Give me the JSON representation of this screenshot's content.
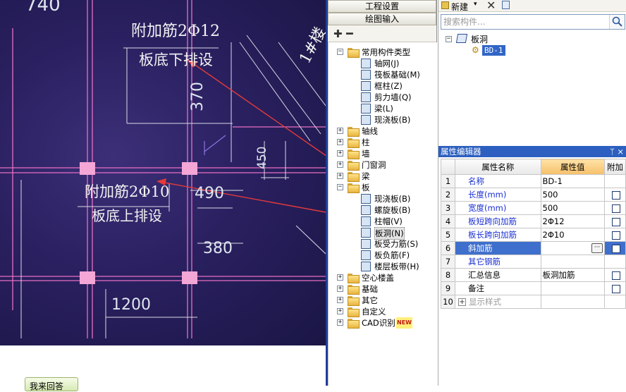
{
  "cad": {
    "top_number": "740",
    "label_upper_line1": "附加筋2Φ12",
    "label_upper_line2": "板底下排设",
    "label_lower_line1": "附加筋2Φ10",
    "label_lower_line2": "板底上排设",
    "dim_370": "370",
    "dim_490": "490",
    "dim_380": "380",
    "dim_1200": "1200",
    "dim_450": "450",
    "diag_text": "1#楼",
    "arrow_color": "#e53a3a"
  },
  "answer_button": "我来回答",
  "nav": {
    "project_settings": "工程设置",
    "drawing_input": "绘图输入",
    "tree": [
      {
        "label": "常用构件类型",
        "icon": "folder-open-icon",
        "expanded": true
      },
      {
        "label": "轴网(J)",
        "icon": "axis-grid-icon"
      },
      {
        "label": "筏板基础(M)",
        "icon": "raft-foundation-icon"
      },
      {
        "label": "框柱(Z)",
        "icon": "frame-column-icon"
      },
      {
        "label": "剪力墙(Q)",
        "icon": "shear-wall-icon"
      },
      {
        "label": "梁(L)",
        "icon": "beam-icon"
      },
      {
        "label": "现浇板(B)",
        "icon": "slab-icon"
      },
      {
        "label": "轴线",
        "icon": "folder-icon"
      },
      {
        "label": "柱",
        "icon": "folder-icon"
      },
      {
        "label": "墙",
        "icon": "folder-icon"
      },
      {
        "label": "门窗洞",
        "icon": "folder-icon"
      },
      {
        "label": "梁",
        "icon": "folder-icon"
      },
      {
        "label": "板",
        "icon": "folder-open-icon",
        "expanded": true
      },
      {
        "label": "现浇板(B)",
        "icon": "slab-icon"
      },
      {
        "label": "螺旋板(B)",
        "icon": "spiral-slab-icon"
      },
      {
        "label": "柱帽(V)",
        "icon": "column-cap-icon"
      },
      {
        "label": "板洞(N)",
        "icon": "slab-hole-icon",
        "selected": true
      },
      {
        "label": "板受力筋(S)",
        "icon": "slab-rebar-icon"
      },
      {
        "label": "板负筋(F)",
        "icon": "negative-rebar-icon"
      },
      {
        "label": "楼层板带(H)",
        "icon": "floor-strip-icon"
      },
      {
        "label": "空心楼盖",
        "icon": "folder-icon"
      },
      {
        "label": "基础",
        "icon": "folder-icon"
      },
      {
        "label": "其它",
        "icon": "folder-icon"
      },
      {
        "label": "自定义",
        "icon": "folder-icon"
      },
      {
        "label": "CAD识别",
        "icon": "folder-icon",
        "badge": "NEW"
      }
    ]
  },
  "list": {
    "new_label": "新建",
    "search_placeholder": "搜索构件...",
    "tree_root": "板洞",
    "tree_child": "BD-1"
  },
  "props": {
    "title": "属性编辑器",
    "pin": "ꟷ",
    "close": "×",
    "headers": {
      "name": "属性名称",
      "value": "属性值",
      "extra": "附加"
    },
    "rows": [
      {
        "n": "1",
        "name": "名称",
        "value": "BD-1",
        "style": "blue",
        "check": false
      },
      {
        "n": "2",
        "name": "长度(mm)",
        "value": "500",
        "style": "blue",
        "check": true
      },
      {
        "n": "3",
        "name": "宽度(mm)",
        "value": "500",
        "style": "blue",
        "check": true
      },
      {
        "n": "4",
        "name": "板短跨向加筋",
        "value": "2Φ12",
        "style": "blue",
        "check": true
      },
      {
        "n": "5",
        "name": "板长跨向加筋",
        "value": "2Φ10",
        "style": "blue",
        "check": true
      },
      {
        "n": "6",
        "name": "斜加筋",
        "value": "",
        "style": "selected",
        "check": true
      },
      {
        "n": "7",
        "name": "其它钢筋",
        "value": "",
        "style": "blue",
        "check": false
      },
      {
        "n": "8",
        "name": "汇总信息",
        "value": "板洞加筋",
        "style": "black",
        "check": true
      },
      {
        "n": "9",
        "name": "备注",
        "value": "",
        "style": "black",
        "check": true
      },
      {
        "n": "10",
        "name": "显示样式",
        "value": "",
        "style": "gray",
        "check": false,
        "expander": "+"
      }
    ]
  }
}
